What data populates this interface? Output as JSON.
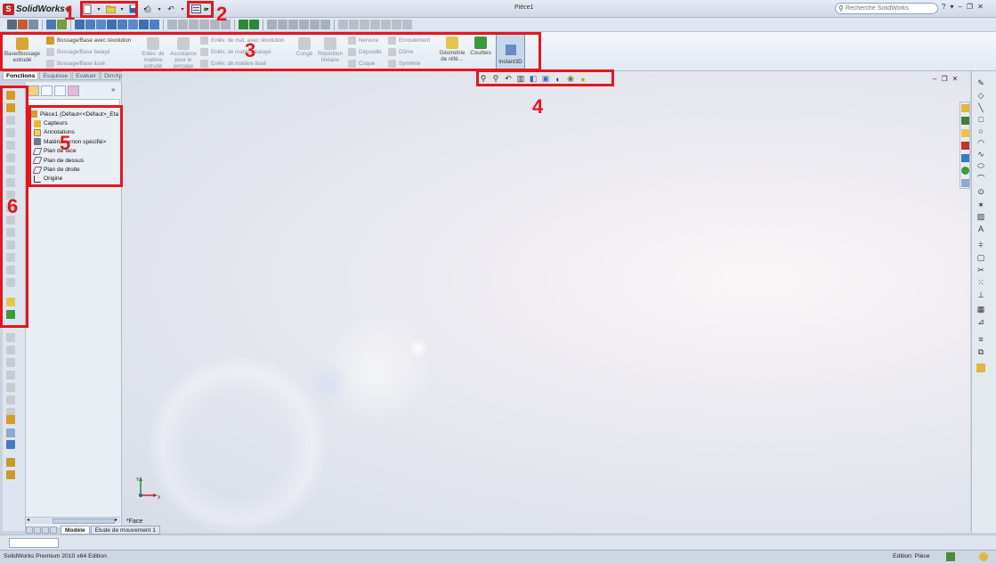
{
  "app": {
    "name": "SolidWorks",
    "doc_title": "Pièce1",
    "search_placeholder": "Recherche SolidWorks",
    "help": "?"
  },
  "command_manager": {
    "base_bossage_extrude": "Base/Bossage extrudé",
    "base_revolution": "Bossage/Base avec révolution",
    "base_balaye": "Bossage/Base balayé",
    "base_lisse": "Bossage/Base lissé",
    "enlev_extrude": "Enlév. de matière extrudé",
    "assistance_percage": "Assistance pour le perçage",
    "enlev_revolution": "Enlév. de mat. avec révolution",
    "enlev_balaye": "Enlév. de matière balayé",
    "enlev_lisse": "Enlév. de matière lissé",
    "conge": "Congé",
    "repetition": "Répétition linéaire",
    "nervure": "Nervure",
    "depouille": "Dépouille",
    "coque": "Coque",
    "enroulement": "Enroulement",
    "dome": "Dôme",
    "symetrie": "Symétrie",
    "geometrie": "Géométrie de réfé…",
    "courbes": "Courbes",
    "instant3d": "Instant3D"
  },
  "tabs": [
    "Fonctions",
    "Esquisse",
    "Evaluer",
    "DimXpert"
  ],
  "tree": {
    "root": "Pièce1  (Défaut<<Défaut>_Eta",
    "items": [
      "Capteurs",
      "Annotations",
      "Matériau <non spécifié>",
      "Plan de face",
      "Plan de dessus",
      "Plan de droite",
      "Origine"
    ]
  },
  "viewport": {
    "face_label": "*Face",
    "axis_x": "X",
    "axis_y": "Y"
  },
  "bottom_tabs": [
    "Modèle",
    "Etude de mouvement 1"
  ],
  "status": {
    "edition_left": "SolidWorks Premium 2010 x64 Edition",
    "edition_right": "Edition: Pièce"
  },
  "annotations": [
    "1",
    "2",
    "3",
    "4",
    "5",
    "6"
  ],
  "colors": {
    "annotation_red": "#e2171e",
    "brand_red": "#c0262d"
  }
}
